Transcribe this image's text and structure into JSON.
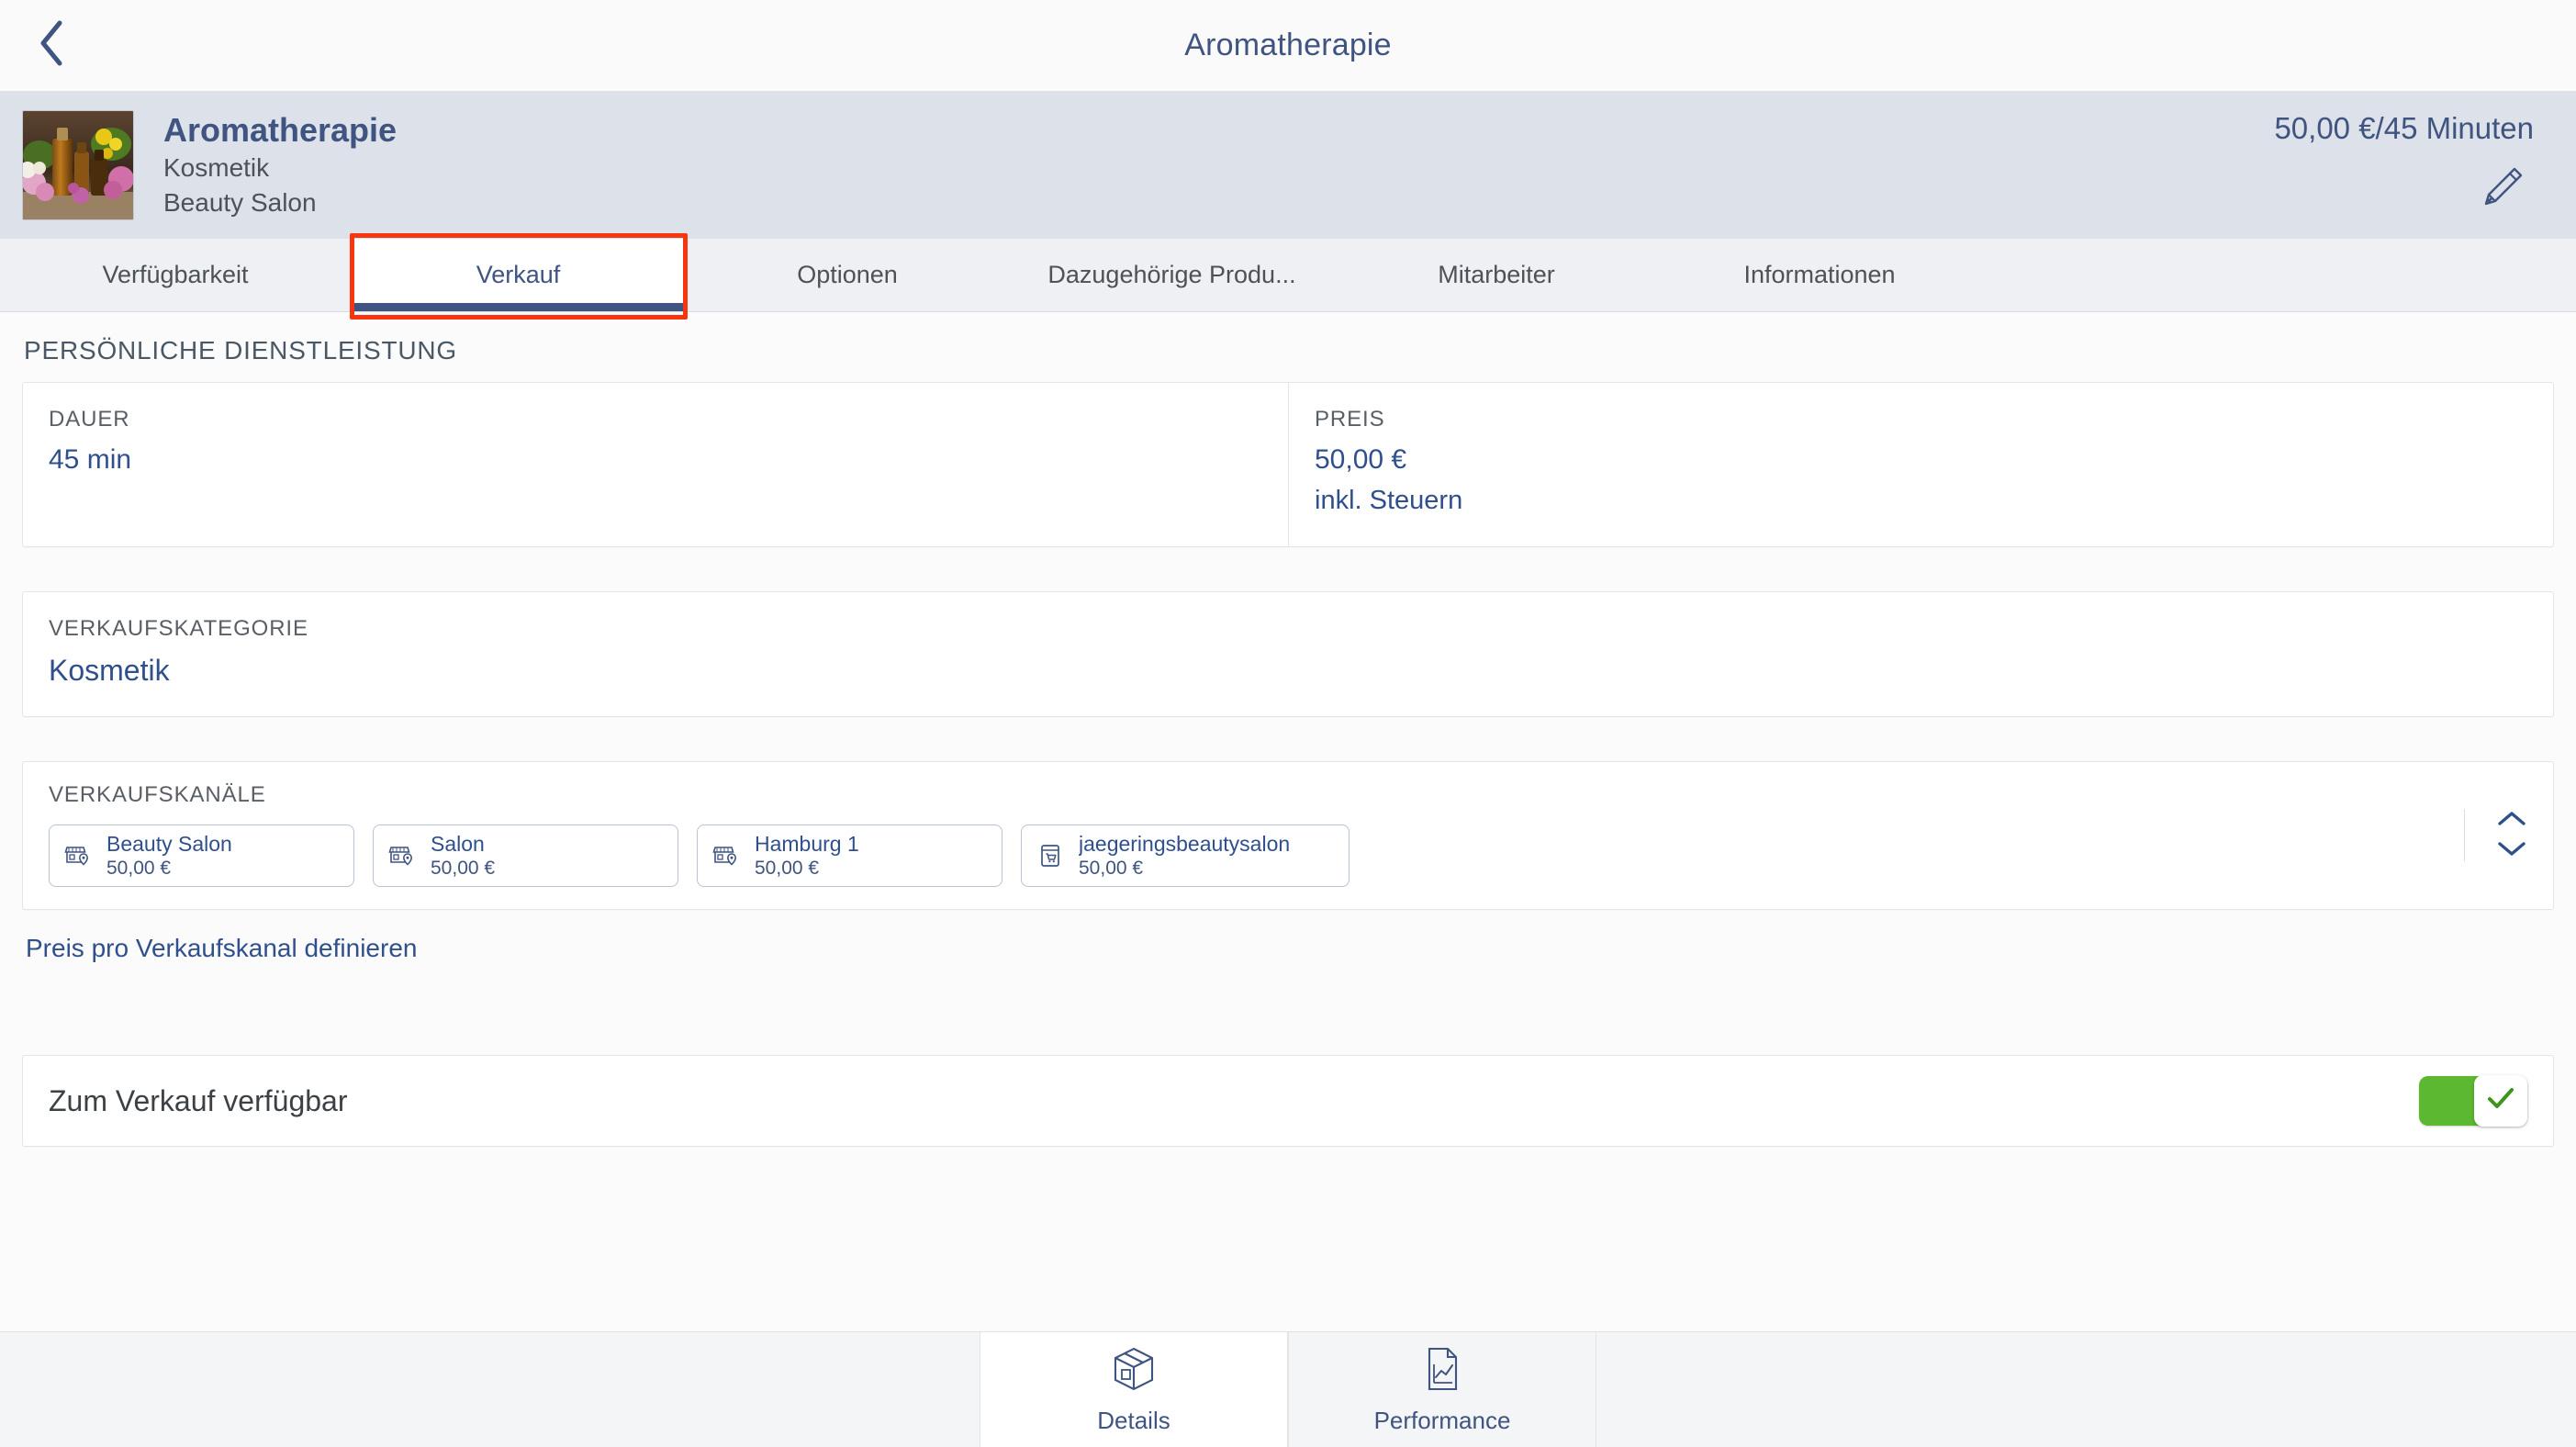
{
  "navbar": {
    "back_icon": "chevron-left-icon",
    "title": "Aromatherapie"
  },
  "product_header": {
    "thumbnail_alt": "aromatherapy-oil-bottles-photo",
    "title": "Aromatherapie",
    "category": "Kosmetik",
    "location": "Beauty Salon",
    "price_duration": "50,00 €/45 Minuten",
    "edit_icon": "pencil-icon"
  },
  "tabs": {
    "items": [
      {
        "label": "Verfügbarkeit",
        "active": false
      },
      {
        "label": "Verkauf",
        "active": true
      },
      {
        "label": "Optionen",
        "active": false
      },
      {
        "label": "Dazugehörige Produ...",
        "active": false
      },
      {
        "label": "Mitarbeiter",
        "active": false
      },
      {
        "label": "Informationen",
        "active": false
      }
    ],
    "highlight_color": "#f8350f",
    "active_indicator_color": "#3f5480"
  },
  "main": {
    "section_title": "PERSÖNLICHE DIENSTLEISTUNG",
    "duration": {
      "label": "DAUER",
      "value": "45 min"
    },
    "price": {
      "label": "PREIS",
      "value": "50,00 €",
      "tax_note": "inkl. Steuern"
    },
    "sales_category": {
      "label": "VERKAUFSKATEGORIE",
      "value": "Kosmetik"
    },
    "sales_channels": {
      "label": "VERKAUFSKANÄLE",
      "items": [
        {
          "name": "Beauty Salon",
          "price": "50,00 €",
          "icon": "store-location-icon"
        },
        {
          "name": "Salon",
          "price": "50,00 €",
          "icon": "store-location-icon"
        },
        {
          "name": "Hamburg 1",
          "price": "50,00 €",
          "icon": "store-location-icon"
        },
        {
          "name": "jaegeringsbeautysalon",
          "price": "50,00 €",
          "icon": "online-shop-icon"
        }
      ],
      "stepper_up_icon": "chevron-up-icon",
      "stepper_down_icon": "chevron-down-icon"
    },
    "define_price_link": "Preis pro Verkaufskanal definieren",
    "available_toggle": {
      "label": "Zum Verkauf verfügbar",
      "state": "on",
      "on_color": "#5cb731",
      "knob_icon": "check-icon"
    }
  },
  "bottombar": {
    "items": [
      {
        "label": "Details",
        "icon": "box-3d-icon",
        "active": true
      },
      {
        "label": "Performance",
        "icon": "document-chart-icon",
        "active": false
      }
    ]
  },
  "colors": {
    "accent_blue": "#2f4f8d",
    "header_blue": "#3f5480",
    "header_band": "#dde1e9",
    "tab_band": "#eef0f4"
  }
}
